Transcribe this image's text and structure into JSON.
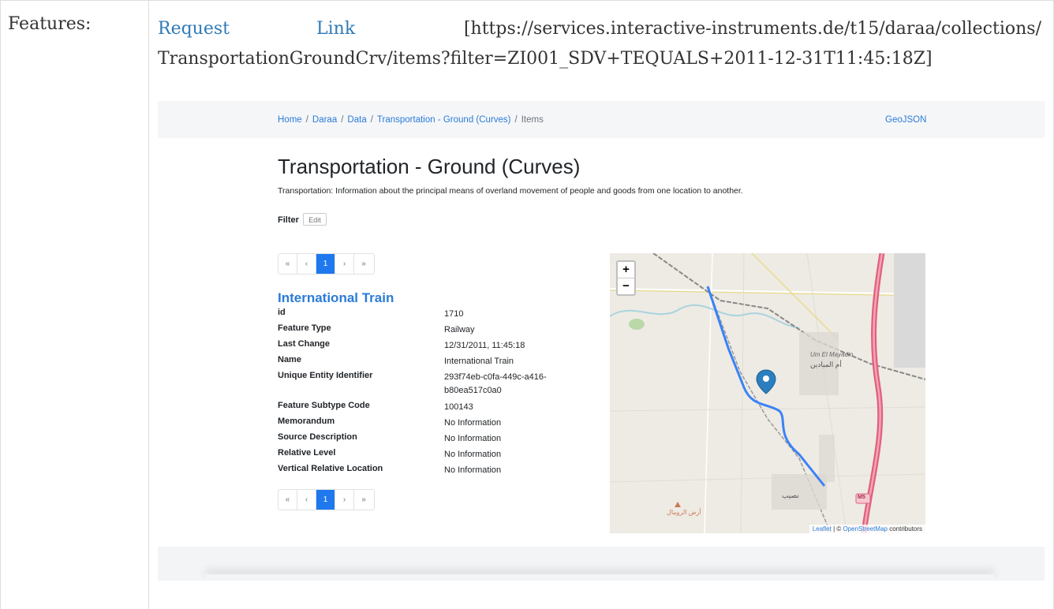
{
  "field_label": "Features:",
  "request": {
    "word1": "Request",
    "word2": "Link",
    "url_part1": "[https://services.interactive-instruments.de/t15/daraa/collections/",
    "url_part2": "TransportationGroundCrv/items?filter=ZI001_SDV+TEQUALS+2011-12-31T11:45:18Z]"
  },
  "breadcrumb": {
    "home": "Home",
    "daraa": "Daraa",
    "data": "Data",
    "collection": "Transportation - Ground (Curves)",
    "current": "Items",
    "separator": "/"
  },
  "geojson_link": "GeoJSON",
  "page_title": "Transportation - Ground (Curves)",
  "description": "Transportation: Information about the principal means of overland movement of people and goods from one location to another.",
  "filter": {
    "label": "Filter",
    "edit": "Edit"
  },
  "pager": {
    "first": "«",
    "prev": "‹",
    "page": "1",
    "next": "›",
    "last": "»"
  },
  "feature": {
    "title": "International Train",
    "properties": [
      {
        "key": "id",
        "value": "1710"
      },
      {
        "key": "Feature Type",
        "value": "Railway"
      },
      {
        "key": "Last Change",
        "value": "12/31/2011, 11:45:18"
      },
      {
        "key": "Name",
        "value": "International Train"
      },
      {
        "key": "Unique Entity Identifier",
        "value": "293f74eb-c0fa-449c-a416-b80ea517c0a0"
      },
      {
        "key": "Feature Subtype Code",
        "value": "100143"
      },
      {
        "key": "Memorandum",
        "value": "No Information"
      },
      {
        "key": "Source Description",
        "value": "No Information"
      },
      {
        "key": "Relative Level",
        "value": "No Information"
      },
      {
        "key": "Vertical Relative Location",
        "value": "No Information"
      }
    ]
  },
  "map": {
    "zoom_in": "+",
    "zoom_out": "−",
    "attribution_leaflet": "Leaflet",
    "attribution_sep": " | © ",
    "attribution_osm": "OpenStreetMap",
    "attribution_tail": " contributors",
    "place_um_el_mayadin_latin": "Um El Mayadin",
    "place_um_el_mayadin_ar": "أم الميادين",
    "place_nasib_ar": "نصيب",
    "place_ard_ar": "أرض الرومال",
    "road_badge": "M5",
    "route_color": "#3b82f6",
    "highway_color": "#e0607e"
  }
}
